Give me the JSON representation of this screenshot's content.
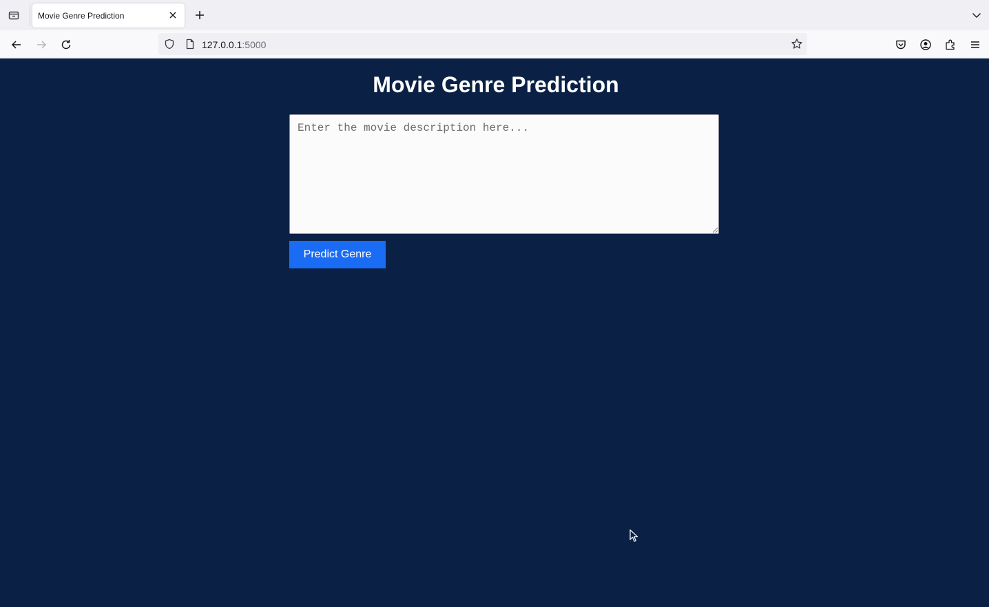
{
  "browser": {
    "tab": {
      "title": "Movie Genre Prediction"
    },
    "url": {
      "host": "127.0.0.1",
      "port": ":5000"
    }
  },
  "page": {
    "title": "Movie Genre Prediction",
    "description_input": {
      "placeholder": "Enter the movie description here...",
      "value": ""
    },
    "predict_button_label": "Predict Genre"
  },
  "colors": {
    "background": "#0a2145",
    "button": "#1a6cf5",
    "title": "#ffffff"
  }
}
